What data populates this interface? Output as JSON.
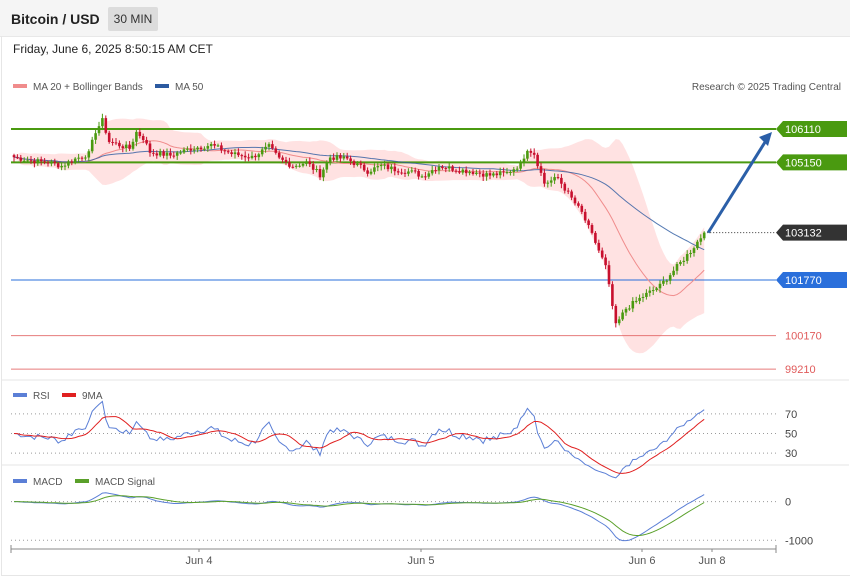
{
  "header": {
    "title": "Bitcoin / USD",
    "timeframe": "30 MIN"
  },
  "date_line": "Friday, June 6, 2025 8:50:15 AM CET",
  "credit": "Research © 2025 Trading Central",
  "colors": {
    "ma20": "#f08c8c",
    "ma50": "#2c5aa0",
    "bands": "#ffd6d6",
    "resistance": "#4a9a10",
    "support": "#2a6fdb",
    "support_low": "#e05a5a",
    "up": "#4a9a10",
    "down": "#c8102e",
    "arrow": "#2b5fa8",
    "rsi": "#5b7fd6",
    "rsi_ma": "#e02020",
    "macd": "#5b7fd6",
    "macd_signal": "#5aa02a"
  },
  "chart_data": [
    {
      "type": "candlestick",
      "name": "price",
      "legend": [
        {
          "name": "MA 20 + Bollinger Bands",
          "color": "#f08c8c"
        },
        {
          "name": "MA 50",
          "color": "#2c5aa0"
        }
      ],
      "x_ticks": [
        "Jun 4",
        "Jun 5",
        "Jun 6",
        "Jun 8"
      ],
      "levels": [
        {
          "label": "106110",
          "value": 106110,
          "kind": "resistance"
        },
        {
          "label": "105150",
          "value": 105150,
          "kind": "resistance"
        },
        {
          "label": "103132",
          "value": 103132,
          "kind": "last"
        },
        {
          "label": "101770",
          "value": 101770,
          "kind": "support"
        },
        {
          "label": "100170",
          "value": 100170,
          "kind": "support_low"
        },
        {
          "label": "99210",
          "value": 99210,
          "kind": "support_low"
        }
      ],
      "forecast": {
        "from": 103132,
        "to": 106110
      },
      "anchors": [
        [
          0,
          105300
        ],
        [
          5,
          105200
        ],
        [
          10,
          105150
        ],
        [
          14,
          105050
        ],
        [
          18,
          105250
        ],
        [
          22,
          105400
        ],
        [
          24,
          106050
        ],
        [
          26,
          106350
        ],
        [
          28,
          105750
        ],
        [
          31,
          105650
        ],
        [
          34,
          105550
        ],
        [
          36,
          106020
        ],
        [
          38,
          105850
        ],
        [
          40,
          105450
        ],
        [
          46,
          105350
        ],
        [
          52,
          105550
        ],
        [
          58,
          105650
        ],
        [
          64,
          105400
        ],
        [
          70,
          105300
        ],
        [
          75,
          105600
        ],
        [
          78,
          105250
        ],
        [
          82,
          105050
        ],
        [
          86,
          105150
        ],
        [
          90,
          104800
        ],
        [
          93,
          105300
        ],
        [
          98,
          105250
        ],
        [
          104,
          104900
        ],
        [
          108,
          105050
        ],
        [
          112,
          104950
        ],
        [
          118,
          104850
        ],
        [
          120,
          104750
        ],
        [
          125,
          105050
        ],
        [
          130,
          104950
        ],
        [
          135,
          104880
        ],
        [
          140,
          104780
        ],
        [
          145,
          104850
        ],
        [
          149,
          105100
        ],
        [
          151,
          105550
        ],
        [
          153,
          105400
        ],
        [
          156,
          104550
        ],
        [
          160,
          104700
        ],
        [
          163,
          104250
        ],
        [
          167,
          103700
        ],
        [
          171,
          102850
        ],
        [
          174,
          102150
        ],
        [
          177,
          100450
        ],
        [
          180,
          100950
        ],
        [
          185,
          101300
        ],
        [
          190,
          101600
        ],
        [
          195,
          102150
        ],
        [
          199,
          102600
        ],
        [
          203,
          103132
        ]
      ]
    },
    {
      "type": "line",
      "name": "RSI",
      "series": [
        {
          "name": "RSI",
          "color": "#5b7fd6"
        },
        {
          "name": "9MA",
          "color": "#e02020"
        }
      ],
      "y_ticks": [
        70,
        50,
        30
      ],
      "ylim": [
        20,
        80
      ]
    },
    {
      "type": "line",
      "name": "MACD",
      "series": [
        {
          "name": "MACD",
          "color": "#5b7fd6"
        },
        {
          "name": "MACD Signal",
          "color": "#5aa02a"
        }
      ],
      "y_ticks": [
        0,
        -1000
      ],
      "ylim": [
        -1200,
        300
      ]
    }
  ]
}
